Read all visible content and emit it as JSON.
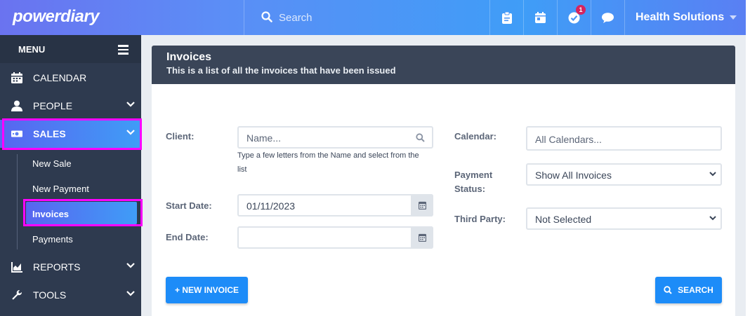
{
  "app": {
    "logo": "powerdiary",
    "account_name": "Health Solutions"
  },
  "search": {
    "placeholder": "Search"
  },
  "topbar": {
    "icons": [
      "clipboard-icon",
      "calendar-icon",
      "checkmark-circle-icon",
      "chat-icon"
    ],
    "notification_count": "1"
  },
  "sidebar": {
    "menu_label": "MENU",
    "items": [
      {
        "label": "CALENDAR",
        "icon": "calendar-icon"
      },
      {
        "label": "PEOPLE",
        "icon": "person-icon"
      },
      {
        "label": "SALES",
        "icon": "money-icon"
      },
      {
        "label": "REPORTS",
        "icon": "chart-icon"
      },
      {
        "label": "TOOLS",
        "icon": "wrench-icon"
      }
    ],
    "sales_sub": [
      "New Sale",
      "New Payment",
      "Invoices",
      "Payments"
    ]
  },
  "page": {
    "title": "Invoices",
    "subtitle": "This is a list of all the invoices that have been issued"
  },
  "form": {
    "client_label": "Client:",
    "client_placeholder": "Name...",
    "client_help": "Type a few letters from the Name and select from the list",
    "start_date_label": "Start Date:",
    "start_date_value": "01/11/2023",
    "end_date_label": "End Date:",
    "end_date_value": "",
    "calendar_label": "Calendar:",
    "calendar_placeholder": "All Calendars...",
    "payment_status_label": "Payment Status:",
    "payment_status_value": "Show All Invoices",
    "third_party_label": "Third Party:",
    "third_party_value": "Not Selected"
  },
  "buttons": {
    "new_invoice": "+ NEW INVOICE",
    "search": "SEARCH"
  },
  "colors": {
    "accent": "#1d8cf8",
    "sidebar": "#2e3a4f",
    "highlight": "#ff00ff",
    "badge": "#d6245f"
  }
}
